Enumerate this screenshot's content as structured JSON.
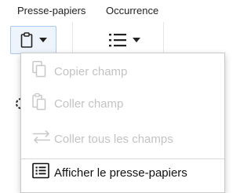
{
  "toolbar": {
    "clipboard_label": "Presse-papiers",
    "occurrence_label": "Occurrence"
  },
  "icons": {
    "clipboard": "clipboard-icon",
    "list": "list-icon",
    "caret": "caret-down-icon",
    "copy": "copy-icon",
    "paste": "paste-icon",
    "paste_all": "arrows-icon",
    "show_clipboard": "list-box-icon",
    "settings_partial": "gear-icon"
  },
  "menu": {
    "items": [
      {
        "label": "Copier champ",
        "disabled": true
      },
      {
        "label": "Coller champ",
        "disabled": true
      },
      {
        "label": "Coller tous les champs",
        "disabled": true
      },
      {
        "label": "Afficher le presse-papiers",
        "disabled": false
      }
    ]
  },
  "colors": {
    "active_border": "#a9c9ee",
    "active_bg": "#eef4fb",
    "disabled_text": "#c3c3c3"
  }
}
